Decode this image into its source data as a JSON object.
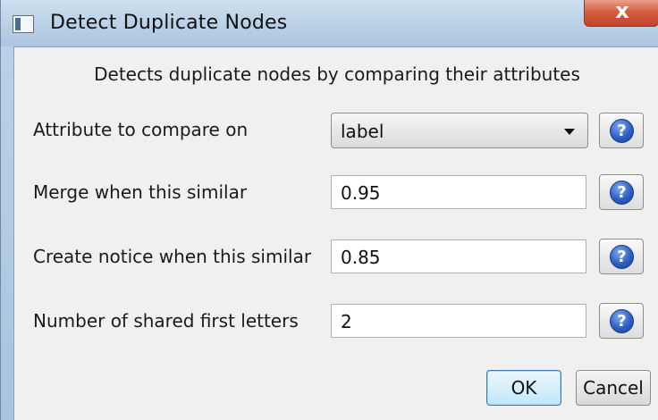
{
  "window": {
    "title": "Detect Duplicate Nodes",
    "close_glyph": "x",
    "app_icon": "window-app-icon"
  },
  "dialog": {
    "description": "Detects duplicate nodes by comparing their attributes",
    "rows": [
      {
        "label": "Attribute to compare on",
        "value": "label",
        "kind": "dropdown",
        "help_icon": "help-question-icon"
      },
      {
        "label": "Merge when this similar",
        "value": "0.95",
        "kind": "text",
        "help_icon": "help-question-icon"
      },
      {
        "label": "Create notice when this similar",
        "value": "0.85",
        "kind": "text",
        "help_icon": "help-question-icon"
      },
      {
        "label": "Number of shared first letters",
        "value": "2",
        "kind": "text",
        "help_icon": "help-question-icon"
      }
    ],
    "help_glyph": "?",
    "buttons": {
      "ok": "OK",
      "cancel": "Cancel"
    }
  },
  "colors": {
    "title_bar": "#b9d0e6",
    "close_button": "#d35e3e",
    "help_icon": "#2f5fc4",
    "ok_focus": "#3d7bad"
  }
}
